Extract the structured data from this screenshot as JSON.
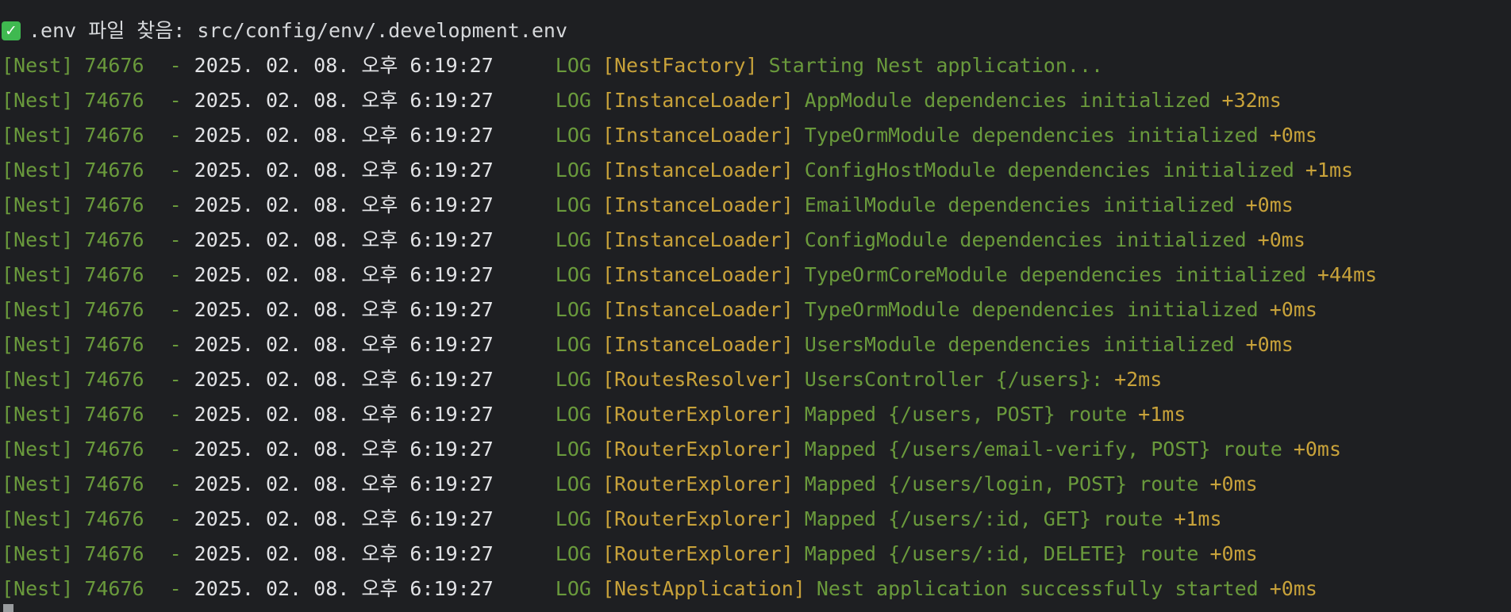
{
  "env_notice": {
    "icon": "check-mark-icon",
    "text": ".env 파일 찾음: src/config/env/.development.env"
  },
  "logs": [
    {
      "tag": "[Nest]",
      "pid": "74676",
      "dash": "-",
      "timestamp": "2025. 02. 08. 오후 6:19:27",
      "level": "LOG",
      "context": "[NestFactory]",
      "message": "Starting Nest application...",
      "delta": ""
    },
    {
      "tag": "[Nest]",
      "pid": "74676",
      "dash": "-",
      "timestamp": "2025. 02. 08. 오후 6:19:27",
      "level": "LOG",
      "context": "[InstanceLoader]",
      "message": "AppModule dependencies initialized",
      "delta": "+32ms"
    },
    {
      "tag": "[Nest]",
      "pid": "74676",
      "dash": "-",
      "timestamp": "2025. 02. 08. 오후 6:19:27",
      "level": "LOG",
      "context": "[InstanceLoader]",
      "message": "TypeOrmModule dependencies initialized",
      "delta": "+0ms"
    },
    {
      "tag": "[Nest]",
      "pid": "74676",
      "dash": "-",
      "timestamp": "2025. 02. 08. 오후 6:19:27",
      "level": "LOG",
      "context": "[InstanceLoader]",
      "message": "ConfigHostModule dependencies initialized",
      "delta": "+1ms"
    },
    {
      "tag": "[Nest]",
      "pid": "74676",
      "dash": "-",
      "timestamp": "2025. 02. 08. 오후 6:19:27",
      "level": "LOG",
      "context": "[InstanceLoader]",
      "message": "EmailModule dependencies initialized",
      "delta": "+0ms"
    },
    {
      "tag": "[Nest]",
      "pid": "74676",
      "dash": "-",
      "timestamp": "2025. 02. 08. 오후 6:19:27",
      "level": "LOG",
      "context": "[InstanceLoader]",
      "message": "ConfigModule dependencies initialized",
      "delta": "+0ms"
    },
    {
      "tag": "[Nest]",
      "pid": "74676",
      "dash": "-",
      "timestamp": "2025. 02. 08. 오후 6:19:27",
      "level": "LOG",
      "context": "[InstanceLoader]",
      "message": "TypeOrmCoreModule dependencies initialized",
      "delta": "+44ms"
    },
    {
      "tag": "[Nest]",
      "pid": "74676",
      "dash": "-",
      "timestamp": "2025. 02. 08. 오후 6:19:27",
      "level": "LOG",
      "context": "[InstanceLoader]",
      "message": "TypeOrmModule dependencies initialized",
      "delta": "+0ms"
    },
    {
      "tag": "[Nest]",
      "pid": "74676",
      "dash": "-",
      "timestamp": "2025. 02. 08. 오후 6:19:27",
      "level": "LOG",
      "context": "[InstanceLoader]",
      "message": "UsersModule dependencies initialized",
      "delta": "+0ms"
    },
    {
      "tag": "[Nest]",
      "pid": "74676",
      "dash": "-",
      "timestamp": "2025. 02. 08. 오후 6:19:27",
      "level": "LOG",
      "context": "[RoutesResolver]",
      "message": "UsersController {/users}:",
      "delta": "+2ms"
    },
    {
      "tag": "[Nest]",
      "pid": "74676",
      "dash": "-",
      "timestamp": "2025. 02. 08. 오후 6:19:27",
      "level": "LOG",
      "context": "[RouterExplorer]",
      "message": "Mapped {/users, POST} route",
      "delta": "+1ms"
    },
    {
      "tag": "[Nest]",
      "pid": "74676",
      "dash": "-",
      "timestamp": "2025. 02. 08. 오후 6:19:27",
      "level": "LOG",
      "context": "[RouterExplorer]",
      "message": "Mapped {/users/email-verify, POST} route",
      "delta": "+0ms"
    },
    {
      "tag": "[Nest]",
      "pid": "74676",
      "dash": "-",
      "timestamp": "2025. 02. 08. 오후 6:19:27",
      "level": "LOG",
      "context": "[RouterExplorer]",
      "message": "Mapped {/users/login, POST} route",
      "delta": "+0ms"
    },
    {
      "tag": "[Nest]",
      "pid": "74676",
      "dash": "-",
      "timestamp": "2025. 02. 08. 오후 6:19:27",
      "level": "LOG",
      "context": "[RouterExplorer]",
      "message": "Mapped {/users/:id, GET} route",
      "delta": "+1ms"
    },
    {
      "tag": "[Nest]",
      "pid": "74676",
      "dash": "-",
      "timestamp": "2025. 02. 08. 오후 6:19:27",
      "level": "LOG",
      "context": "[RouterExplorer]",
      "message": "Mapped {/users/:id, DELETE} route",
      "delta": "+0ms"
    },
    {
      "tag": "[Nest]",
      "pid": "74676",
      "dash": "-",
      "timestamp": "2025. 02. 08. 오후 6:19:27",
      "level": "LOG",
      "context": "[NestApplication]",
      "message": "Nest application successfully started",
      "delta": "+0ms"
    }
  ],
  "colors": {
    "background": "#1e1f22",
    "green": "#6a9a3c",
    "yellow": "#c8a23a",
    "timestamp": "#e2e3e6",
    "check": "#3fb950"
  }
}
